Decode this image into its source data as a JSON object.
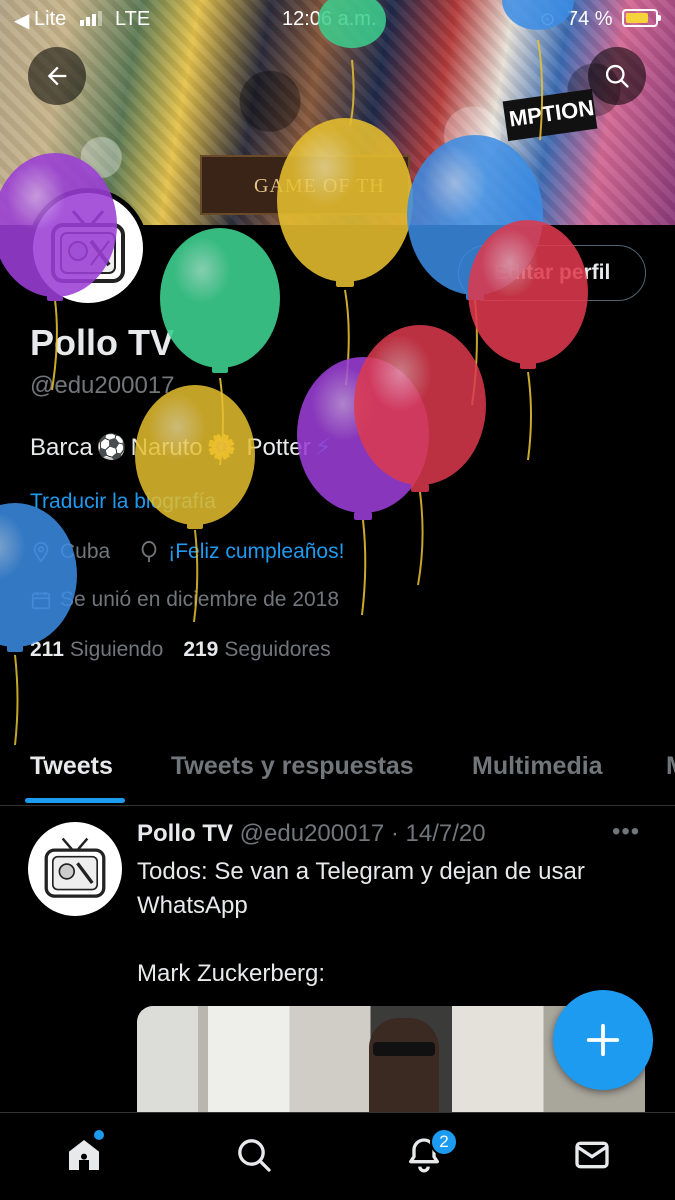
{
  "status_bar": {
    "back_app": "◀",
    "carrier": "Lite",
    "network": "LTE",
    "time": "12:06 a.m.",
    "battery": "74 %"
  },
  "banner": {
    "got_text": "GAME OF TH",
    "mption_text": "MPTION"
  },
  "profile": {
    "edit_button": "Editar perfil",
    "name": "Pollo TV",
    "handle": "@edu200017",
    "bio": [
      "Barca",
      "⚽",
      "Naruto",
      "🌼",
      "Potter",
      "⚡"
    ],
    "translate_link": "Traducir la biografía",
    "location": "Cuba",
    "birthday": "¡Feliz cumpleaños!",
    "joined": "Se unió en diciembre de 2018",
    "following_count": "211",
    "following_label": "Siguiendo",
    "followers_count": "219",
    "followers_label": "Seguidores"
  },
  "tabs": [
    "Tweets",
    "Tweets y respuestas",
    "Multimedia",
    "M"
  ],
  "tweet": {
    "author": "Pollo TV",
    "handle_date": "@edu200017 · 14/7/20",
    "more": "•••",
    "text": "Todos: Se van a Telegram y dejan de usar WhatsApp\n\nMark Zuckerberg:"
  },
  "bottom_nav": {
    "notifications_badge": "2"
  },
  "colors": {
    "accent": "#1d9bf0",
    "background": "#000000",
    "secondary_text": "#71767b"
  }
}
